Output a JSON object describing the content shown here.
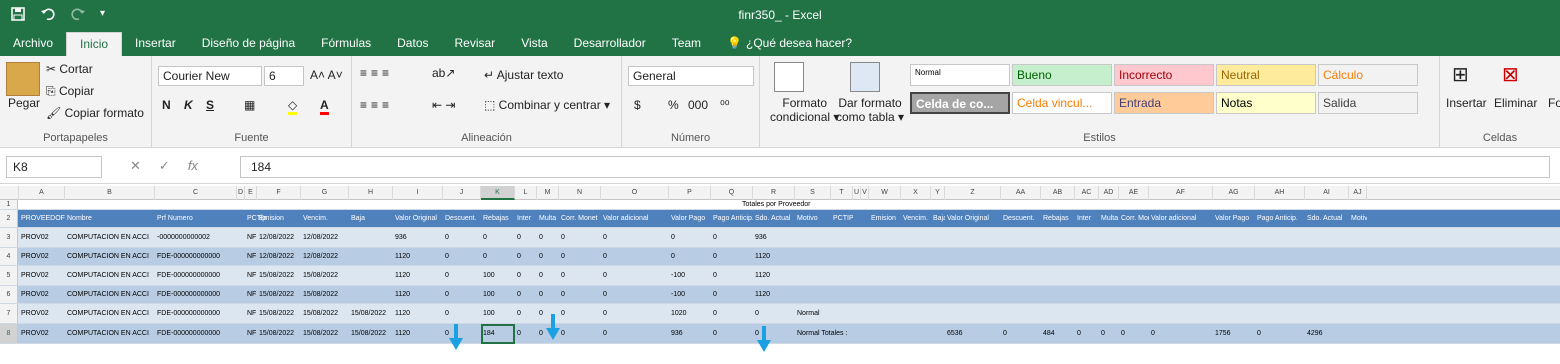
{
  "window": {
    "title": "finr350_ - Excel"
  },
  "qat": {
    "save_icon": "save-icon",
    "undo_icon": "undo-icon",
    "redo_icon": "redo-icon",
    "customize_icon": "customize-icon"
  },
  "tabs": [
    "Archivo",
    "Inicio",
    "Insertar",
    "Diseño de página",
    "Fórmulas",
    "Datos",
    "Revisar",
    "Vista",
    "Desarrollador",
    "Team",
    "¿Qué desea hacer?"
  ],
  "ribbon": {
    "portapapeles": {
      "label": "Portapapeles",
      "pegar": "Pegar",
      "cortar": "Cortar",
      "copiar": "Copiar",
      "copiar_formato": "Copiar formato"
    },
    "fuente": {
      "label": "Fuente",
      "font_name": "Courier New",
      "font_size": "6",
      "bold": "N",
      "italic": "K",
      "underline": "S"
    },
    "alineacion": {
      "label": "Alineación",
      "ajustar": "Ajustar texto",
      "combinar": "Combinar y centrar"
    },
    "numero": {
      "label": "Número",
      "format": "General",
      "currency": "$",
      "percent": "%",
      "thousands": "000"
    },
    "estilos": {
      "label": "Estilos",
      "formato_condicional": "Formato",
      "formato_condicional2": "condicional",
      "dar_formato": "Dar formato",
      "dar_formato2": "como tabla",
      "styles": [
        {
          "name": "Normal",
          "bg": "#ffffff",
          "fg": "#000000"
        },
        {
          "name": "Bueno",
          "bg": "#c6efce",
          "fg": "#006100"
        },
        {
          "name": "Incorrecto",
          "bg": "#ffc7ce",
          "fg": "#9c0006"
        },
        {
          "name": "Neutral",
          "bg": "#ffeb9c",
          "fg": "#9c6500"
        },
        {
          "name": "Cálculo",
          "bg": "#f2f2f2",
          "fg": "#fa7d00"
        },
        {
          "name": "Celda de co...",
          "bg": "#a5a5a5",
          "fg": "#ffffff"
        },
        {
          "name": "Celda vincul...",
          "bg": "#ffffff",
          "fg": "#fa7d00"
        },
        {
          "name": "Entrada",
          "bg": "#ffcc99",
          "fg": "#3f3f76"
        },
        {
          "name": "Notas",
          "bg": "#ffffcc",
          "fg": "#000000"
        },
        {
          "name": "Salida",
          "bg": "#f2f2f2",
          "fg": "#3f3f3f"
        }
      ]
    },
    "celdas": {
      "label": "Celdas",
      "insertar": "Insertar",
      "eliminar": "Eliminar",
      "formato": "Form"
    }
  },
  "formula_bar": {
    "name_box": "K8",
    "cancel": "✕",
    "enter": "✓",
    "fx": "fx",
    "value": "184"
  },
  "columns": [
    "A",
    "B",
    "C",
    "D",
    "E",
    "F",
    "G",
    "H",
    "I",
    "J",
    "K",
    "L",
    "M",
    "N",
    "O",
    "P",
    "Q",
    "R",
    "S",
    "T",
    "U",
    "V",
    "W",
    "X",
    "Y",
    "Z",
    "AA",
    "AB",
    "AC",
    "AD",
    "AE",
    "AF",
    "AG",
    "AH",
    "AI",
    "AJ"
  ],
  "rows": [
    {
      "num": "1",
      "cells": {
        "title": "Totales por Proveedor"
      }
    },
    {
      "num": "2",
      "header": true,
      "cells": [
        "PROVEEDOF",
        "Nombre",
        "Prf Numero",
        "PCTip",
        "Emision",
        "Vencim.",
        "Baja",
        "Valor Original",
        "Descuent.",
        "Rebajas",
        "Inter",
        "Multa",
        "Corr. Monet",
        "Valor adicional",
        "Valor Pago",
        "Pago Anticip.",
        "Sdo. Actual",
        "Motivo",
        "PCTIP",
        "Emision",
        "Vencim.",
        "Baja",
        "Valor Original",
        "Descuent.",
        "Rebajas",
        "Inter",
        "Multa",
        "Corr. Monet",
        "Valor adicional",
        "Valor Pago",
        "Pago Anticip.",
        "Sdo. Actual",
        "Motivo"
      ]
    },
    {
      "num": "3",
      "cells": [
        "PROV02",
        "COMPUTACION EN ACCI",
        "-0000000000002",
        "NF",
        "12/08/2022",
        "12/08/2022",
        "",
        "936",
        "0",
        "0",
        "0",
        "0",
        "0",
        "0",
        "0",
        "0",
        "936",
        "",
        "",
        "",
        "",
        "",
        "",
        "",
        "",
        "",
        "",
        "",
        "",
        "",
        "",
        "",
        ""
      ]
    },
    {
      "num": "4",
      "cells": [
        "PROV02",
        "COMPUTACION EN ACCI",
        "FDE-000000000000",
        "NF",
        "12/08/2022",
        "12/08/2022",
        "",
        "1120",
        "0",
        "0",
        "0",
        "0",
        "0",
        "0",
        "0",
        "0",
        "1120",
        "",
        "",
        "",
        "",
        "",
        "",
        "",
        "",
        "",
        "",
        "",
        "",
        "",
        "",
        "",
        ""
      ]
    },
    {
      "num": "5",
      "cells": [
        "PROV02",
        "COMPUTACION EN ACCI",
        "FDE-000000000000",
        "NF",
        "15/08/2022",
        "15/08/2022",
        "",
        "1120",
        "0",
        "100",
        "0",
        "0",
        "0",
        "0",
        "-100",
        "0",
        "1120",
        "",
        "",
        "",
        "",
        "",
        "",
        "",
        "",
        "",
        "",
        "",
        "",
        "",
        "",
        "",
        ""
      ]
    },
    {
      "num": "6",
      "cells": [
        "PROV02",
        "COMPUTACION EN ACCI",
        "FDE-000000000000",
        "NF",
        "15/08/2022",
        "15/08/2022",
        "",
        "1120",
        "0",
        "100",
        "0",
        "0",
        "0",
        "0",
        "-100",
        "0",
        "1120",
        "",
        "",
        "",
        "",
        "",
        "",
        "",
        "",
        "",
        "",
        "",
        "",
        "",
        "",
        "",
        ""
      ]
    },
    {
      "num": "7",
      "cells": [
        "PROV02",
        "COMPUTACION EN ACCI",
        "FDE-000000000000",
        "NF",
        "15/08/2022",
        "15/08/2022",
        "15/08/2022",
        "1120",
        "0",
        "100",
        "0",
        "0",
        "0",
        "0",
        "1020",
        "0",
        "0",
        "Normal",
        "",
        "",
        "",
        "",
        "",
        "",
        "",
        "",
        "",
        "",
        "",
        "",
        "",
        "",
        ""
      ]
    },
    {
      "num": "8",
      "cells": [
        "PROV02",
        "COMPUTACION EN ACCI",
        "FDE-000000000000",
        "NF",
        "15/08/2022",
        "15/08/2022",
        "15/08/2022",
        "1120",
        "0",
        "184",
        "0",
        "0",
        "0",
        "0",
        "936",
        "0",
        "0",
        "Normal Totales :",
        "",
        "",
        "",
        "",
        "6536",
        "0",
        "484",
        "0",
        "0",
        "0",
        "0",
        "1756",
        "0",
        "4296",
        ""
      ]
    }
  ]
}
